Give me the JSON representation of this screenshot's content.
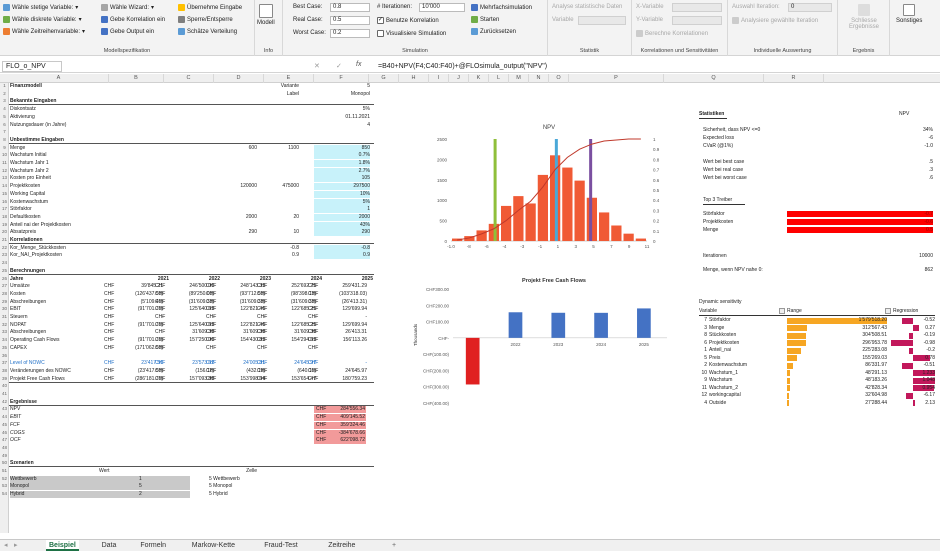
{
  "ribbon": {
    "dist": [
      "Wähle stetige Variable:",
      "Wähle diskrete Variable:",
      "Wähle Zeitreihenvariable:"
    ],
    "wizard": [
      "Wähle Wizard:",
      "Gebe Korrelation ein",
      "Gebe Output ein"
    ],
    "takeover": [
      "Übernehme Eingabe",
      "Sperre/Entsperre",
      "Schätze Verteilung"
    ],
    "model_group_label": "Modellspezifikation",
    "model_btn": "Modell",
    "info_label": "Info",
    "cases": [
      {
        "label": "Best Case:",
        "value": "0.8"
      },
      {
        "label": "Real Case:",
        "value": "0.5"
      },
      {
        "label": "Worst Case:",
        "value": "0.2"
      }
    ],
    "iter_label": "# Iterationen:",
    "iter_value": "10'000",
    "use_corr": "Benutze Korrelation",
    "visualize": "Visualisiere Simulation",
    "multisim": "Mehrfachsimulation",
    "start": "Starten",
    "reset": "Zurücksetzen",
    "sim_label": "Simulation",
    "analyse": "Analyse statistische Daten",
    "variable": "Variable",
    "stat_label": "Statistik",
    "xvar": "X-Variable",
    "yvar": "Y-Variable",
    "calc_corr": "Berechne Korrelationen",
    "corr_label": "Korrelationen und Sensitivitäten",
    "iter_sel": "Auswahl Iteration:",
    "iter_sel_val": "0",
    "analyse_iter": "Analysiere gewählte Iteration",
    "indiv_label": "Individuelle Auswertung",
    "close_results": "Schliesse Ergebnisse",
    "results_label": "Ergebnis",
    "misc": "Sonstiges"
  },
  "formula_bar": {
    "name": "FLO_o_NPV",
    "formula": "=B40+NPV(F4;C40:F40)+@FLOsimula_output(\"NPV\")",
    "fx": "fx",
    "cancel": "✕",
    "confirm": "✓"
  },
  "columns": [
    "A",
    "B",
    "C",
    "D",
    "E",
    "F",
    "G",
    "H",
    "I",
    "J",
    "K",
    "L",
    "M",
    "N",
    "O",
    "P",
    "Q",
    "R",
    "S"
  ],
  "rows": [
    {
      "n": "1",
      "a": "Finanzmodell",
      "e": "Variante",
      "f": "5",
      "bold": true
    },
    {
      "n": "2",
      "e": "Label",
      "f": "Monopol"
    },
    {
      "n": "3",
      "a": "Bekannte Eingaben",
      "bold": true,
      "line": true
    },
    {
      "n": "4",
      "a": "Diskontsatz",
      "f": "5%"
    },
    {
      "n": "5",
      "a": "Aktivierung",
      "f": "01.11.2021"
    },
    {
      "n": "6",
      "a": "Nutzungsdauer (in Jahre)",
      "f": "4"
    },
    {
      "n": "7"
    },
    {
      "n": "8",
      "a": "Unbestimme Eingaben",
      "bold": true,
      "line": true
    },
    {
      "n": "9",
      "a": "Menge",
      "c": "600",
      "e": "1100",
      "f": "850",
      "cyan": true
    },
    {
      "n": "10",
      "a": "Wachstum Initial",
      "f": "0.7%",
      "cyan": true
    },
    {
      "n": "11",
      "a": "Wachstum Jahr 1",
      "f": "1.8%",
      "cyan": true
    },
    {
      "n": "12",
      "a": "Wachstum Jahr 2",
      "f": "2.7%",
      "cyan": true
    },
    {
      "n": "13",
      "a": "Kosten pro Einheit",
      "f": "105",
      "cyan": true
    },
    {
      "n": "14",
      "a": "Projektkosten",
      "c": "120000",
      "e": "475000",
      "f": "297500",
      "cyan": true
    },
    {
      "n": "15",
      "a": "Working Capital",
      "f": "10%",
      "cyan": true
    },
    {
      "n": "16",
      "a": "Kostenwachstum",
      "f": "5%",
      "cyan": true
    },
    {
      "n": "17",
      "a": "Störfaktor",
      "f": "1",
      "cyan": true
    },
    {
      "n": "18",
      "a": "Defaultkosten",
      "c": "2000",
      "e": "20",
      "f": "2000",
      "cyan": true
    },
    {
      "n": "19",
      "a": "Anteil nai der Projektkosten",
      "f": "43%",
      "cyan": true
    },
    {
      "n": "20",
      "a": "Absatzpreis",
      "c": "290",
      "e": "10",
      "f": "290",
      "cyan": true
    },
    {
      "n": "21",
      "a": "Korrelationen",
      "bold": true,
      "line": true
    },
    {
      "n": "22",
      "a": "Kor_Menge_Stückkosten",
      "e": "-0.8",
      "f": "-0.8",
      "cyan": true
    },
    {
      "n": "23",
      "a": "Kor_NAI_Projektkosten",
      "e": "0.9",
      "f": "0.9",
      "cyan": true
    },
    {
      "n": "24"
    },
    {
      "n": "25",
      "a": "Berechnungen",
      "bold": true,
      "line": true
    },
    {
      "n": "26",
      "a": "Jahre",
      "years": [
        "2021",
        "2022",
        "2023",
        "2024",
        "2025"
      ],
      "bold": true
    },
    {
      "n": "27",
      "a": "Umsätze",
      "chf": true,
      "v": [
        "39'845.21",
        "246'500.00",
        "248'143.33",
        "252'692.75",
        "259'431.29"
      ]
    },
    {
      "n": "28",
      "a": "Kosten",
      "chf": true,
      "v": [
        "(126'437.50)",
        "(89'250.00)",
        "(93'712.50)",
        "(98'398.13)",
        "(103'318.03)"
      ]
    },
    {
      "n": "29",
      "a": "Abschreibungen",
      "chf": true,
      "v": [
        "(5'109.46)",
        "(31'609.38)",
        "(31'609.38)",
        "(31'609.38)",
        "(26'413.31)"
      ]
    },
    {
      "n": "30",
      "a": "EBIT",
      "chf": true,
      "v": [
        "(91'701.76)",
        "125'640.63",
        "122'821.46",
        "122'685.25",
        "129'699.94"
      ]
    },
    {
      "n": "31",
      "a": "Steuern",
      "chf": true,
      "v": [
        "-",
        "-",
        "-",
        "-",
        "-"
      ]
    },
    {
      "n": "32",
      "a": "NOPAT",
      "chf": true,
      "v": [
        "(91'701.76)",
        "125'640.63",
        "122'821.46",
        "122'685.25",
        "129'699.94"
      ]
    },
    {
      "n": "33",
      "a": "Abschreibungen",
      "chf": true,
      "v": [
        "",
        "31'609.38",
        "31'609.38",
        "31'609.38",
        "26'413.31"
      ]
    },
    {
      "n": "34",
      "a": "Operating Cash Flows",
      "chf": true,
      "v": [
        "(91'701.76)",
        "157'250.00",
        "154'430.83",
        "154'294.63",
        "156'113.26"
      ]
    },
    {
      "n": "35",
      "a": "CAPEX",
      "chf": true,
      "v": [
        "(171'062.50)",
        "",
        "",
        "",
        ""
      ]
    },
    {
      "n": "36"
    },
    {
      "n": "37",
      "a": "Level of NOWC",
      "chf": true,
      "blue": true,
      "v": [
        "23'417.50",
        "23'573.62",
        "24'005.81",
        "24'645.97",
        "-"
      ]
    },
    {
      "n": "38",
      "a": "Veränderungen des NOWC",
      "chf": true,
      "v": [
        "(23'417.50)",
        "(156.12)",
        "(432.19)",
        "(640.16)",
        "24'645.97"
      ]
    },
    {
      "n": "39",
      "a": "Projekt Free Cash Flows",
      "chf": true,
      "line": true,
      "v": [
        "(286'181.76)",
        "157'093.88",
        "153'998.64",
        "153'654.47",
        "180'759.23"
      ]
    },
    {
      "n": "40"
    },
    {
      "n": "41"
    },
    {
      "n": "42",
      "a": "Ergebnisse",
      "bold": true,
      "line": true
    },
    {
      "n": "43",
      "a": "NPV",
      "red": true,
      "cur": "CHF",
      "f": "284'556.34"
    },
    {
      "n": "44",
      "a": "EBIT",
      "red": true,
      "cur": "CHF",
      "f": "409'145.52",
      "ital": true
    },
    {
      "n": "45",
      "a": "FCF",
      "red": true,
      "cur": "CHF",
      "f": "359'324.46",
      "ital": true
    },
    {
      "n": "46",
      "a": "COGS",
      "red": true,
      "cur": "CHF",
      "f": "-384'678.66",
      "ital": true
    },
    {
      "n": "47",
      "a": "OCF",
      "red": true,
      "cur": "CHF",
      "f": "622'098.72",
      "ital": true
    },
    {
      "n": "48"
    },
    {
      "n": "49"
    },
    {
      "n": "50",
      "a": "Szenarien",
      "bold": true,
      "line": true
    },
    {
      "n": "51",
      "a": "",
      "b": "Wert",
      "c": "Zelle"
    },
    {
      "n": "52",
      "a": "Wettbewerb",
      "gray": true,
      "c": "1",
      "d": "5 Wettbewerb"
    },
    {
      "n": "53",
      "a": "Monopol",
      "gray": true,
      "c": "5",
      "d": "5 Monopol"
    },
    {
      "n": "54",
      "a": "Hybrid",
      "gray": true,
      "c": "2",
      "d": "5 Hybrid"
    }
  ],
  "currency": "CHF",
  "npv_chart": {
    "title": "NPV",
    "ticks": [
      "-1.0",
      "-8",
      "-6",
      "-4",
      "-3",
      "-1",
      "1",
      "3",
      "5",
      "7",
      "9",
      "11"
    ],
    "y_left": [
      "2500",
      "2000",
      "1500",
      "1000",
      "500",
      "0"
    ],
    "y_right": [
      "1",
      "0.9",
      "0.8",
      "0.7",
      "0.6",
      "0.5",
      "0.4",
      "0.3",
      "0.2",
      "0.1",
      "0"
    ],
    "bins": [
      60,
      120,
      260,
      420,
      860,
      1100,
      920,
      1620,
      2100,
      1800,
      1480,
      1060,
      700,
      380,
      180,
      60
    ],
    "cdf": [
      0.01,
      0.03,
      0.07,
      0.12,
      0.2,
      0.3,
      0.39,
      0.53,
      0.7,
      0.82,
      0.9,
      0.95,
      0.98,
      0.99,
      1.0,
      1.0
    ],
    "markers": [
      {
        "bin": 3.6,
        "color": "#8fbf3a"
      },
      {
        "bin": 8.6,
        "color": "#4aa8d8"
      },
      {
        "bin": 11.4,
        "color": "#7a4fa0"
      }
    ],
    "bar_color": "#f05a35",
    "cdf_color": "#c0392b"
  },
  "fcf_chart": {
    "title": "Projekt Free Cash Flows",
    "ylabel": "Thousands",
    "y_ticks": [
      "CHF300.00",
      "CHF200.00",
      "CHF100.00",
      "CHF-",
      "CHF(100.00)",
      "CHF(200.00)",
      "CHF(300.00)",
      "CHF(400.00)"
    ],
    "years": [
      "2021",
      "2022",
      "2023",
      "2024",
      "2025"
    ],
    "values": [
      -286.18,
      157.09,
      154.0,
      153.65,
      180.76
    ],
    "pos_color": "#4472c4",
    "neg_color": "#e02020"
  },
  "stats": {
    "title": "Statistiken",
    "col": "NPV",
    "items": [
      {
        "label": "Sicherheit, dass NPV  <=0",
        "value": "34%"
      },
      {
        "label": "Expected loss",
        "value": "-6"
      },
      {
        "label": "CVaR (@1%)",
        "value": "-1.0"
      },
      {
        "label": "",
        "value": ""
      },
      {
        "label": "Wert bei best case",
        "value": ".5"
      },
      {
        "label": "Wert bei real case",
        "value": ".3"
      },
      {
        "label": "Wert bei worst case",
        "value": ".6"
      }
    ],
    "top3_title": "Top 3 Treiber",
    "top3": [
      {
        "label": "Störfaktor",
        "value": "-0.7"
      },
      {
        "label": "Projektkosten",
        "value": "-0.6"
      },
      {
        "label": "Menge",
        "value": "0.5"
      }
    ],
    "iter_label": "Iterationen",
    "iter_value": "10000",
    "le0_label": "Menge, wenn NPV nahe 0:",
    "le0_value": "862"
  },
  "sensitivity": {
    "title": "Dynamic sensitivity",
    "h_variable": "Variable",
    "h_range": "Range",
    "h_reg": "Regression",
    "rows": [
      {
        "idx": "7",
        "name": "Störfaktor",
        "range": "1'579'518.20",
        "reg": "-0.52",
        "r": 1.0,
        "g": -0.52
      },
      {
        "idx": "3",
        "name": "Menge",
        "range": "312'567.43",
        "reg": "0.27",
        "r": 0.2,
        "g": 0.27
      },
      {
        "idx": "8",
        "name": "Stückkosten",
        "range": "304'508.51",
        "reg": "-0.19",
        "r": 0.19,
        "g": -0.19
      },
      {
        "idx": "6",
        "name": "Projektkosten",
        "range": "296'953.78",
        "reg": "-0.98",
        "r": 0.19,
        "g": -0.98
      },
      {
        "idx": "1",
        "name": "Anteil_nai",
        "range": "225'283.08",
        "reg": "-0.2",
        "r": 0.14,
        "g": -0.2
      },
      {
        "idx": "5",
        "name": "Preis",
        "range": "155'269.03",
        "reg": "0.78",
        "r": 0.1,
        "g": 0.78
      },
      {
        "idx": "2",
        "name": "Kostenwachstum",
        "range": "86'331.97",
        "reg": "-0.51",
        "r": 0.055,
        "g": -0.51
      },
      {
        "idx": "10",
        "name": "Wachstum_1",
        "range": "48'291.13",
        "reg": "1.233",
        "r": 0.03,
        "g": 1.23
      },
      {
        "idx": "9",
        "name": "Wachstum",
        "range": "48'183.26",
        "reg": "1.048",
        "r": 0.03,
        "g": 1.05
      },
      {
        "idx": "11",
        "name": "Wachstum_2",
        "range": "42'828.34",
        "reg": "0.954",
        "r": 0.027,
        "g": 0.95
      },
      {
        "idx": "12",
        "name": "workingcapital",
        "range": "32'604.98",
        "reg": "-6.17",
        "r": 0.02,
        "g": -0.3
      },
      {
        "idx": "4",
        "name": "Outside",
        "range": "27'288.44",
        "reg": "2.13",
        "r": 0.017,
        "g": 0.1
      }
    ],
    "range_color": "#f6a623",
    "reg_color": "#c2185b"
  },
  "tabs": [
    "Beispiel",
    "Data",
    "Formeln",
    "Markow-Kette",
    "Fraud-Test",
    "Zeitreihe"
  ],
  "add_tab": "+"
}
